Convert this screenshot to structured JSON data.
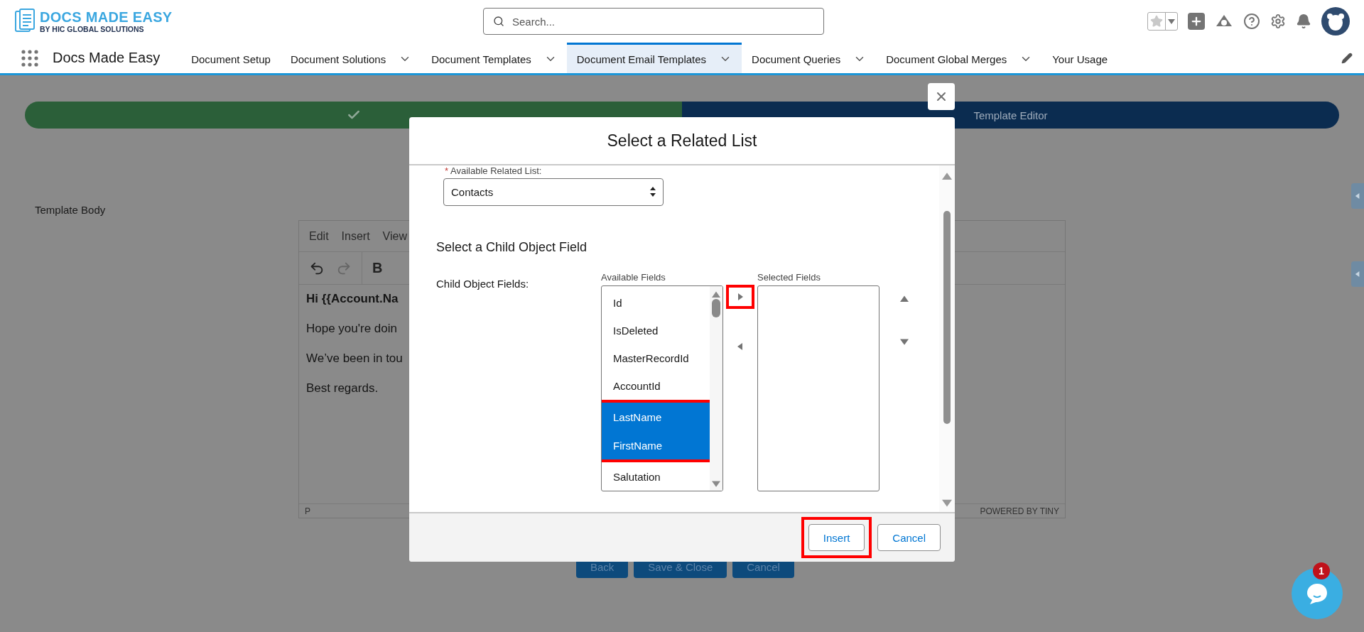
{
  "brand": {
    "title": "DOCS MADE EASY",
    "subtitle": "BY HIC GLOBAL SOLUTIONS"
  },
  "search": {
    "placeholder": "Search..."
  },
  "nav": {
    "app_name": "Docs Made Easy",
    "tabs": [
      {
        "label": "Document Setup",
        "dropdown": false,
        "selected": false
      },
      {
        "label": "Document Solutions",
        "dropdown": true,
        "selected": false
      },
      {
        "label": "Document Templates",
        "dropdown": true,
        "selected": false
      },
      {
        "label": "Document Email Templates",
        "dropdown": true,
        "selected": true
      },
      {
        "label": "Document Queries",
        "dropdown": true,
        "selected": false
      },
      {
        "label": "Document Global Merges",
        "dropdown": true,
        "selected": false
      },
      {
        "label": "Your Usage",
        "dropdown": false,
        "selected": false
      }
    ]
  },
  "progress": {
    "steps": [
      {
        "kind": "complete"
      },
      {
        "kind": "current",
        "label": "Template Editor"
      }
    ]
  },
  "editor": {
    "label": "Template Body",
    "menu": [
      "Edit",
      "Insert",
      "View"
    ],
    "lines": [
      {
        "text": "Hi {{Account.Na",
        "bold": true
      },
      {
        "text": "Hope you're doin",
        "bold": false
      },
      {
        "text": "We’ve been in tou",
        "bold": false
      },
      {
        "text": "Best regards.",
        "bold": false
      }
    ],
    "bold_tool": "B",
    "path": "P",
    "branding": "POWERED BY TINY"
  },
  "page_buttons": [
    "Back",
    "Save & Close",
    "Cancel"
  ],
  "modal": {
    "title": "Select a Related List",
    "related_list": {
      "label": "Available Related List:",
      "required_mark": "*",
      "value": "Contacts"
    },
    "section_title": "Select a Child Object Field",
    "fields_label": "Child Object Fields:",
    "available_label": "Available Fields",
    "selected_label": "Selected Fields",
    "available_fields": [
      {
        "label": "Id",
        "selected": false
      },
      {
        "label": "IsDeleted",
        "selected": false
      },
      {
        "label": "MasterRecordId",
        "selected": false
      },
      {
        "label": "AccountId",
        "selected": false
      },
      {
        "label": "LastName",
        "selected": true
      },
      {
        "label": "FirstName",
        "selected": true
      },
      {
        "label": "Salutation",
        "selected": false
      }
    ],
    "highlight_selected": true,
    "add_highlighted": true,
    "buttons": [
      {
        "label": "Insert",
        "highlighted": true
      },
      {
        "label": "Cancel",
        "highlighted": false
      }
    ]
  },
  "chat": {
    "badge": "1"
  }
}
